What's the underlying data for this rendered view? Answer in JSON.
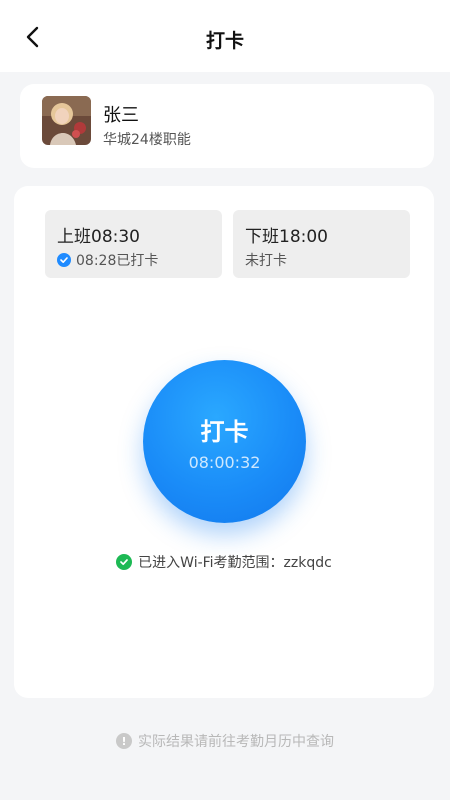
{
  "nav": {
    "title": "打卡",
    "back_icon": "chevron-left-icon"
  },
  "profile": {
    "name": "张三",
    "department": "华城24楼职能"
  },
  "shifts": [
    {
      "label": "上班08:30",
      "status": "08:28已打卡",
      "icon": "check-circle-icon",
      "icon_color": "#1f8bff"
    },
    {
      "label": "下班18:00",
      "status": "未打卡"
    }
  ],
  "clock_button": {
    "label": "打卡",
    "time": "08:00:32",
    "color": "#1a8cf8"
  },
  "wifi": {
    "text": "已进入Wi-Fi考勤范围：zzkqdc",
    "icon": "check-circle-icon",
    "icon_color": "#1db954"
  },
  "footer": {
    "note": "实际结果请前往考勤月历中查询",
    "icon": "info-icon"
  }
}
